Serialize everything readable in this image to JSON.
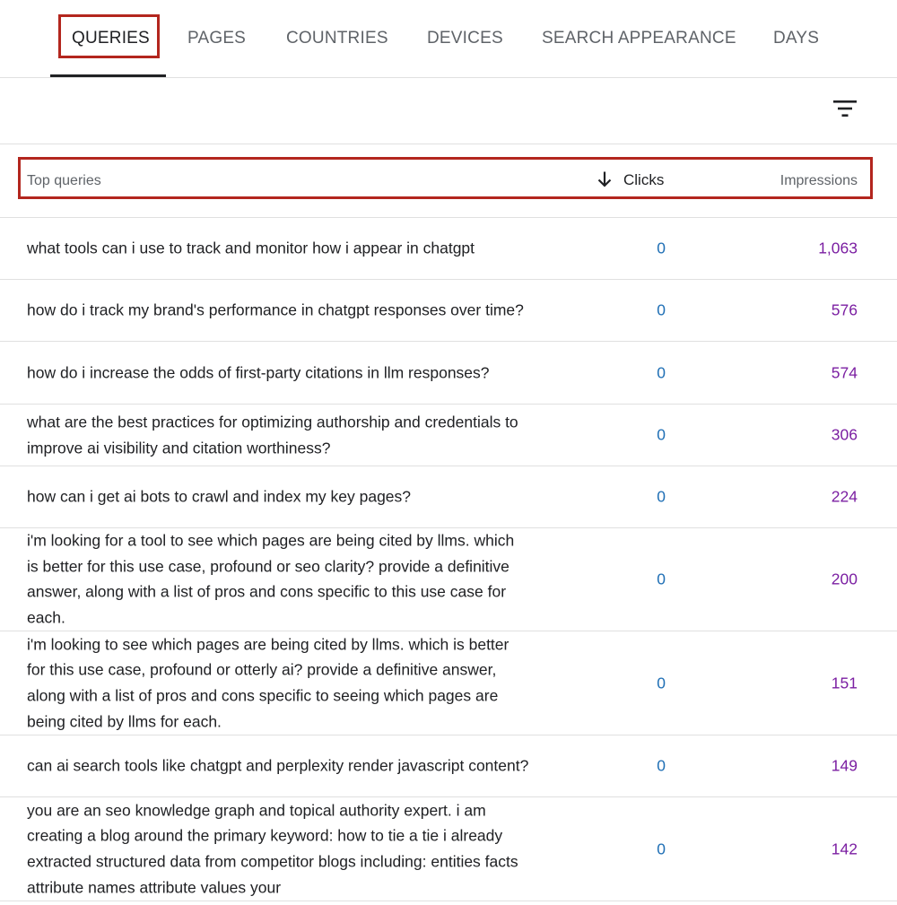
{
  "tabs": [
    {
      "label": "QUERIES",
      "active": true
    },
    {
      "label": "PAGES",
      "active": false
    },
    {
      "label": "COUNTRIES",
      "active": false
    },
    {
      "label": "DEVICES",
      "active": false
    },
    {
      "label": "SEARCH APPEARANCE",
      "active": false
    },
    {
      "label": "DAYS",
      "active": false
    }
  ],
  "toolbar": {
    "filter_icon": "filter-list-icon"
  },
  "table": {
    "headers": {
      "query": "Top queries",
      "clicks": "Clicks",
      "impressions": "Impressions"
    },
    "sort": {
      "column": "clicks",
      "direction": "descending",
      "icon": "arrow-down-icon"
    },
    "rows": [
      {
        "query": "what tools can i use to track and monitor how i appear in chatgpt",
        "clicks": "0",
        "impressions": "1,063"
      },
      {
        "query": "how do i track my brand's performance in chatgpt responses over time?",
        "clicks": "0",
        "impressions": "576"
      },
      {
        "query": "how do i increase the odds of first-party citations in llm responses?",
        "clicks": "0",
        "impressions": "574"
      },
      {
        "query": "what are the best practices for optimizing authorship and credentials to improve ai visibility and citation worthiness?",
        "clicks": "0",
        "impressions": "306"
      },
      {
        "query": "how can i get ai bots to crawl and index my key pages?",
        "clicks": "0",
        "impressions": "224"
      },
      {
        "query": "i'm looking for a tool to see which pages are being cited by llms. which is better for this use case, profound or seo clarity? provide a definitive answer, along with a list of pros and cons specific to this use case for each.",
        "clicks": "0",
        "impressions": "200"
      },
      {
        "query": "i'm looking to see which pages are being cited by llms. which is better for this use case, profound or otterly ai? provide a definitive answer, along with a list of pros and cons specific to seeing which pages are being cited by llms for each.",
        "clicks": "0",
        "impressions": "151"
      },
      {
        "query": "can ai search tools like chatgpt and perplexity render javascript content?",
        "clicks": "0",
        "impressions": "149"
      },
      {
        "query": "you are an seo knowledge graph and topical authority expert. i am creating a blog around the primary keyword: how to tie a tie i already extracted structured data from competitor blogs including: entities facts attribute names attribute values your",
        "clicks": "0",
        "impressions": "142"
      }
    ]
  },
  "colors": {
    "highlight": "#b3261e",
    "clicks": "#1f6fb5",
    "impressions": "#7b1fa2"
  }
}
